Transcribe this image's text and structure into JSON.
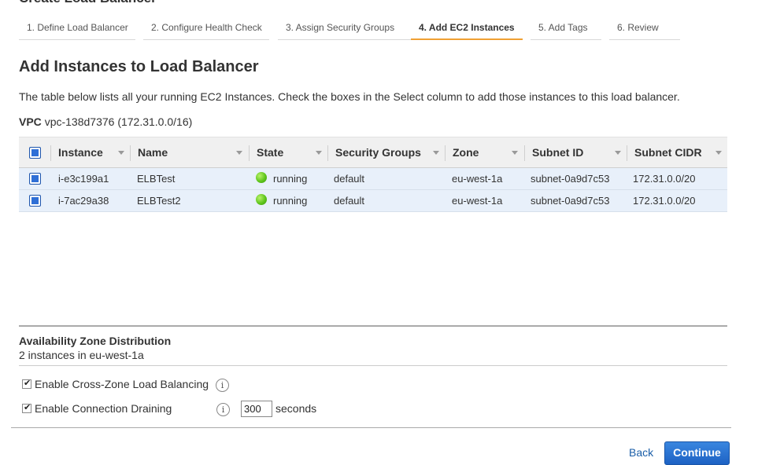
{
  "dialog": {
    "title": "Create Load Balancer",
    "close_glyph": "×"
  },
  "steps": [
    {
      "label": "1. Define Load Balancer",
      "active": false
    },
    {
      "label": "2. Configure Health Check",
      "active": false
    },
    {
      "label": "3. Assign Security Groups",
      "active": false
    },
    {
      "label": "4. Add EC2 Instances",
      "active": true
    },
    {
      "label": "5. Add Tags",
      "active": false
    },
    {
      "label": "6. Review",
      "active": false
    }
  ],
  "page": {
    "title": "Add Instances to Load Balancer",
    "description": "The table below lists all your running EC2 Instances. Check the boxes in the Select column to add those instances to this load balancer.",
    "vpc_label": "VPC",
    "vpc_value": "vpc-138d7376 (172.31.0.0/16)"
  },
  "table": {
    "columns": [
      "Instance",
      "Name",
      "State",
      "Security Groups",
      "Zone",
      "Subnet ID",
      "Subnet CIDR"
    ],
    "rows": [
      {
        "selected": true,
        "instance": "i-e3c199a1",
        "name": "ELBTest",
        "state": "running",
        "security_groups": "default",
        "zone": "eu-west-1a",
        "subnet_id": "subnet-0a9d7c53",
        "subnet_cidr": "172.31.0.0/20"
      },
      {
        "selected": true,
        "instance": "i-7ac29a38",
        "name": "ELBTest2",
        "state": "running",
        "security_groups": "default",
        "zone": "eu-west-1a",
        "subnet_id": "subnet-0a9d7c53",
        "subnet_cidr": "172.31.0.0/20"
      }
    ]
  },
  "availability": {
    "title": "Availability Zone Distribution",
    "text": "2 instances in eu-west-1a"
  },
  "options": {
    "cross_zone_label": "Enable Cross-Zone Load Balancing",
    "cross_zone_checked": true,
    "draining_label": "Enable Connection Draining",
    "draining_checked": true,
    "draining_timeout": "300",
    "draining_unit": "seconds",
    "info_glyph": "i"
  },
  "footer": {
    "back_label": "Back",
    "continue_label": "Continue"
  },
  "colors": {
    "accent": "#f0a033",
    "row_selected": "#e8f0fa",
    "status_running": "#5fc51c",
    "primary_button": "#1d62c4"
  }
}
